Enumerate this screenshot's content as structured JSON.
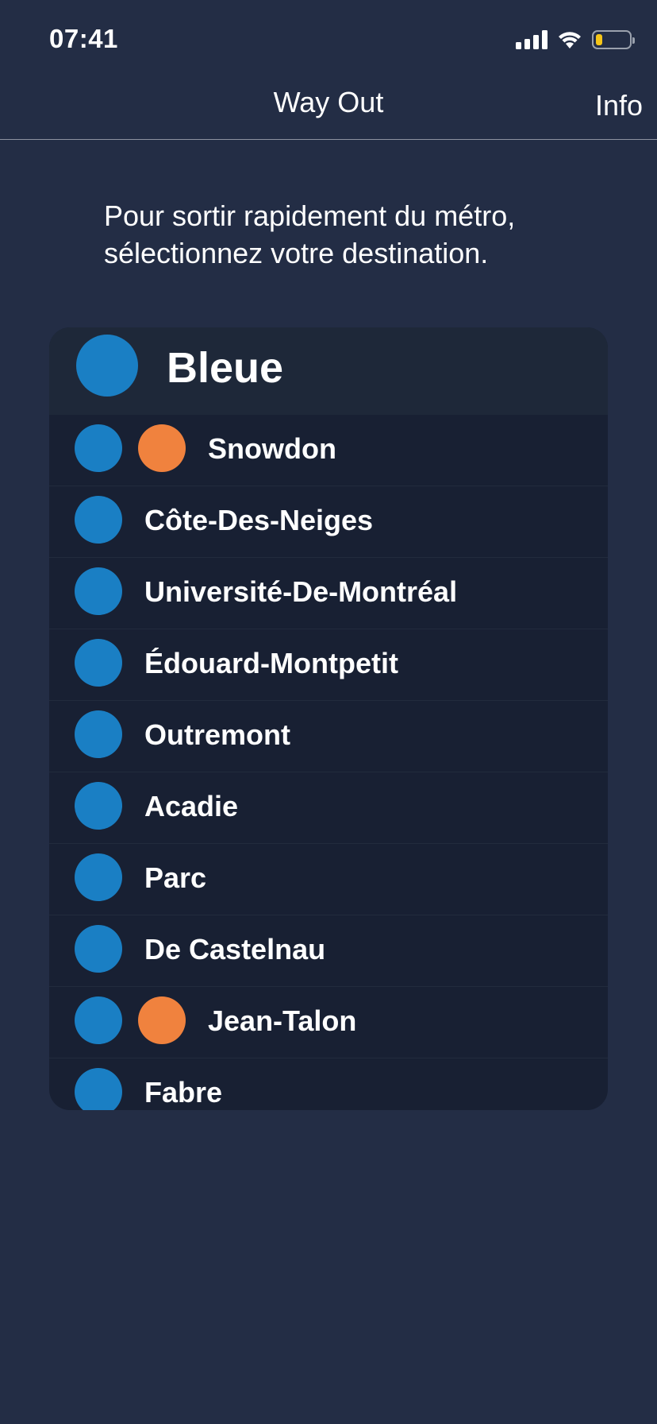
{
  "status_bar": {
    "time": "07:41",
    "icons": [
      "cellular-signal-icon",
      "wifi-icon",
      "battery-icon"
    ],
    "battery_level": 0.2
  },
  "nav": {
    "title": "Way Out",
    "info_label": "Info"
  },
  "instruction": "Pour sortir rapidement du métro, sélectionnez votre destination.",
  "colors": {
    "background": "#232d45",
    "blue_line": "#1a7fc4",
    "orange_line": "#f0823e",
    "card": "#182033",
    "card_header": "#1e2839"
  },
  "line": {
    "name": "Bleue",
    "color": "#1a7fc4"
  },
  "stations": [
    {
      "name": "Snowdon",
      "transfer": true
    },
    {
      "name": "Côte-Des-Neiges",
      "transfer": false
    },
    {
      "name": "Université-De-Montréal",
      "transfer": false
    },
    {
      "name": "Édouard-Montpetit",
      "transfer": false
    },
    {
      "name": "Outremont",
      "transfer": false
    },
    {
      "name": "Acadie",
      "transfer": false
    },
    {
      "name": "Parc",
      "transfer": false
    },
    {
      "name": "De Castelnau",
      "transfer": false
    },
    {
      "name": "Jean-Talon",
      "transfer": true
    },
    {
      "name": "Fabre",
      "transfer": false
    }
  ]
}
